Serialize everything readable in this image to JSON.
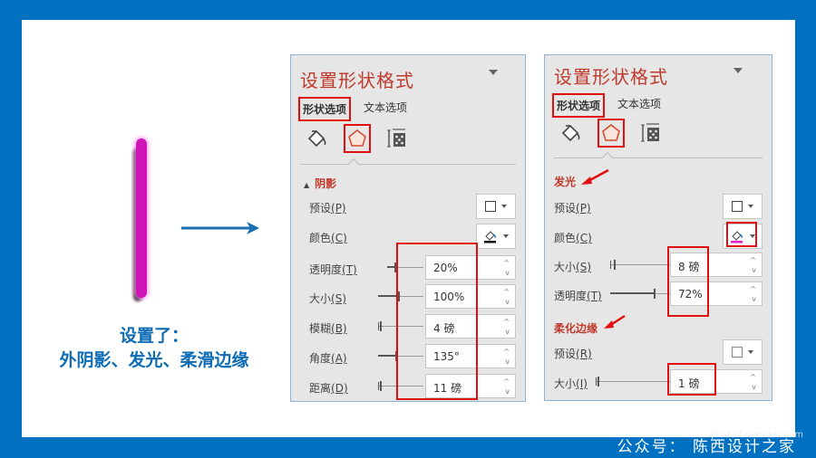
{
  "caption": {
    "line1": "设置了：",
    "line2": "外阴影、发光、柔滑边缘"
  },
  "footer": {
    "text": "公众号：  陈西设计之家",
    "watermark": "post of uimaker.com"
  },
  "colors": {
    "frame": "#0070c0",
    "shape": "#d015b8",
    "highlight": "#e01010",
    "title": "#c0392b",
    "caption": "#0e6bb5"
  },
  "panel_left": {
    "title": "设置形状格式",
    "tabs": [
      {
        "label": "形状选项",
        "active": true
      },
      {
        "label": "文本选项",
        "active": false
      }
    ],
    "icons": [
      "fill-line-icon",
      "effects-pentagon-icon",
      "size-properties-icon"
    ],
    "section": {
      "label": "阴影",
      "collapse": "▲"
    },
    "rows": {
      "preset": {
        "label": "预设",
        "key": "(P)"
      },
      "color": {
        "label": "颜色",
        "key": "(C)"
      },
      "transparency": {
        "label": "透明度",
        "key": "(T)",
        "value": "20%"
      },
      "size": {
        "label": "大小",
        "key": "(S)",
        "value": "100%"
      },
      "blur": {
        "label": "模糊",
        "key": "(B)",
        "value": "4 磅"
      },
      "angle": {
        "label": "角度",
        "key": "(A)",
        "value": "135°"
      },
      "distance": {
        "label": "距离",
        "key": "(D)",
        "value": "11 磅"
      }
    }
  },
  "panel_right": {
    "title": "设置形状格式",
    "tabs": [
      {
        "label": "形状选项",
        "active": true
      },
      {
        "label": "文本选项",
        "active": false
      }
    ],
    "icons": [
      "fill-line-icon",
      "effects-pentagon-icon",
      "size-properties-icon"
    ],
    "glow": {
      "label": "发光",
      "preset": {
        "label": "预设",
        "key": "(P)"
      },
      "color": {
        "label": "颜色",
        "key": "(C)",
        "swatch": "#e020c8"
      },
      "size": {
        "label": "大小",
        "key": "(S)",
        "value": "8 磅"
      },
      "transparency": {
        "label": "透明度",
        "key": "(T)",
        "value": "72%"
      }
    },
    "soft_edges": {
      "label": "柔化边缘",
      "preset": {
        "label": "预设",
        "key": "(R)"
      },
      "size": {
        "label": "大小",
        "key": "(I)",
        "value": "1 磅"
      }
    }
  }
}
